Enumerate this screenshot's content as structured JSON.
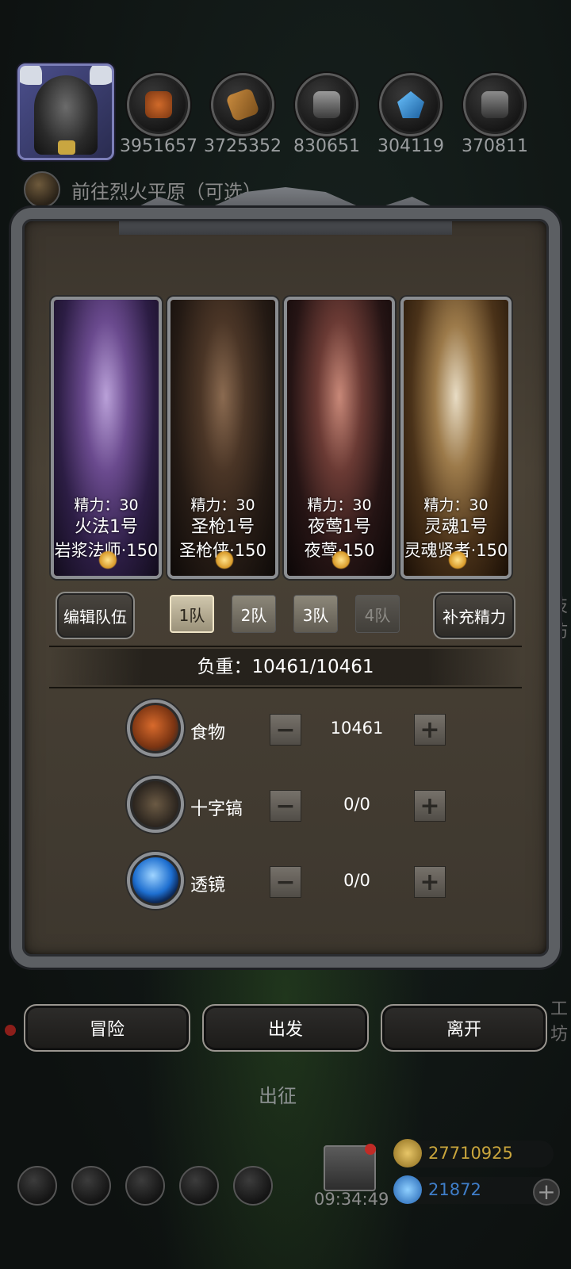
{
  "header": {
    "resources": [
      {
        "icon": "meat-icon",
        "value": "3951657"
      },
      {
        "icon": "wood-icon",
        "value": "3725352"
      },
      {
        "icon": "iron-ingot-icon",
        "value": "830651"
      },
      {
        "icon": "crystal-icon",
        "value": "304119"
      },
      {
        "icon": "silver-ingot-icon",
        "value": "370811"
      }
    ],
    "goto_label": "前往烈火平原（可选）"
  },
  "team": {
    "heroes": [
      {
        "stamina": "精力：30",
        "name": "火法1号",
        "class_level": "岩浆法师·150",
        "theme": "witch"
      },
      {
        "stamina": "精力：30",
        "name": "圣枪1号",
        "class_level": "圣枪侠·150",
        "theme": "gunslinger"
      },
      {
        "stamina": "精力：30",
        "name": "夜莺1号",
        "class_level": "夜莺·150",
        "theme": "nightingale"
      },
      {
        "stamina": "精力：30",
        "name": "灵魂1号",
        "class_level": "灵魂贤者·150",
        "theme": "sage"
      }
    ],
    "edit_label": "编辑队伍",
    "tabs": [
      "1队",
      "2队",
      "3队",
      "4队"
    ],
    "selected_tab": "1队",
    "refill_label": "补充精力"
  },
  "load": {
    "label": "负重：10461/10461"
  },
  "supplies": [
    {
      "icon": "meat-icon",
      "name": "食物",
      "value": "10461"
    },
    {
      "icon": "pickaxe-icon",
      "name": "十字镐",
      "value": "0/0"
    },
    {
      "icon": "lens-icon",
      "name": "透镜",
      "value": "0/0"
    }
  ],
  "actions": {
    "adventure": "冒险",
    "depart": "出发",
    "leave": "离开"
  },
  "expedition_label": "出征",
  "footer": {
    "clock": "09:34:49",
    "gold": "27710925",
    "gems": "21872"
  },
  "edge_text": {
    "right_upper": "技坊",
    "right_lower": "工坊"
  },
  "colors": {
    "accent_red": "#c5401e",
    "gold_text": "#c9a53c",
    "gem_text": "#3f7ec9"
  }
}
